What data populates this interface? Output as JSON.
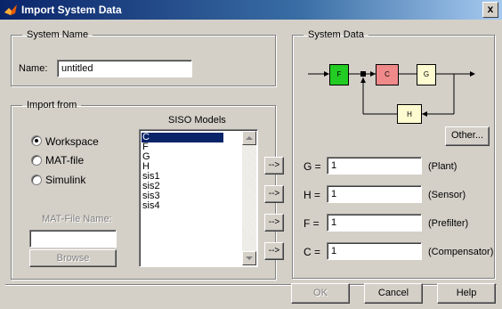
{
  "window": {
    "title": "Import System Data",
    "close_glyph": "x"
  },
  "system_name": {
    "legend": "System Name",
    "label": "Name:",
    "value": "untitled"
  },
  "import_from": {
    "legend": "Import from",
    "options": [
      "Workspace",
      "MAT-file",
      "Simulink"
    ],
    "selected": "Workspace",
    "siso_label": "SISO Models",
    "models": [
      "C",
      "F",
      "G",
      "H",
      "sis1",
      "sis2",
      "sis3",
      "sis4"
    ],
    "selected_model": "C",
    "matfile_label": "MAT-File Name:",
    "matfile_value": "",
    "browse_label": "Browse"
  },
  "arrow_buttons": [
    "-->",
    "-->",
    "-->",
    "-->"
  ],
  "system_data": {
    "legend": "System Data",
    "blocks": {
      "F": "F",
      "C": "C",
      "G": "G",
      "H": "H"
    },
    "block_colors": {
      "F": "#22cc22",
      "C": "#f08a8a",
      "G": "#fffbd0",
      "H": "#fffbd0"
    },
    "other_label": "Other...",
    "fields": [
      {
        "label": "G =",
        "value": "1",
        "desc": "(Plant)"
      },
      {
        "label": "H =",
        "value": "1",
        "desc": "(Sensor)"
      },
      {
        "label": "F =",
        "value": "1",
        "desc": "(Prefilter)"
      },
      {
        "label": "C =",
        "value": "1",
        "desc": "(Compensator)"
      }
    ]
  },
  "footer": {
    "ok_label": "OK",
    "cancel_label": "Cancel",
    "help_label": "Help"
  }
}
